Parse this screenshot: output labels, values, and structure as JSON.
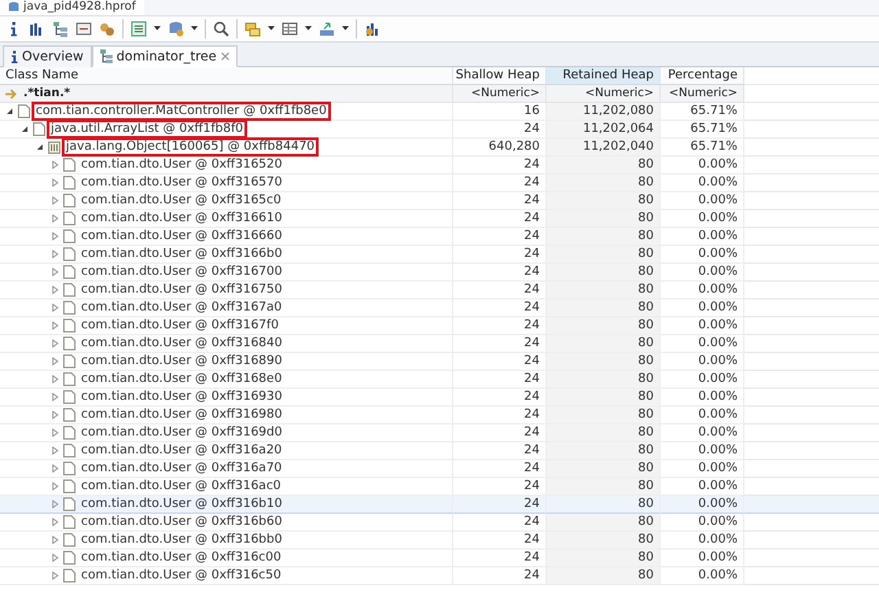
{
  "editor_tab": {
    "title": "java_pid4928.hprof"
  },
  "view_tabs": [
    {
      "label": "Overview",
      "selected": false
    },
    {
      "label": "dominator_tree",
      "selected": true
    }
  ],
  "table": {
    "columns": [
      {
        "label": "Class Name",
        "sorted": false
      },
      {
        "label": "Shallow Heap",
        "sorted": false
      },
      {
        "label": "Retained Heap",
        "sorted": true
      },
      {
        "label": "Percentage",
        "sorted": false
      }
    ],
    "filter": {
      "class_name": ".*tian.*",
      "shallow": "<Numeric>",
      "retained": "<Numeric>",
      "percentage": "<Numeric>"
    },
    "rows": [
      {
        "kind": "object",
        "name": "com.tian.controller.MatController @ 0xff1fb8e0",
        "shallow": "16",
        "retained": "11,202,080",
        "percentage": "65.71%",
        "expanded": true,
        "annotated": true,
        "selected": false,
        "children": [
          {
            "kind": "object",
            "name": "java.util.ArrayList @ 0xff1fb8f0",
            "shallow": "24",
            "retained": "11,202,064",
            "percentage": "65.71%",
            "expanded": true,
            "annotated": true,
            "selected": false,
            "children": [
              {
                "kind": "array",
                "name": "java.lang.Object[160065] @ 0xffb84470",
                "shallow": "640,280",
                "retained": "11,202,040",
                "percentage": "65.71%",
                "expanded": true,
                "annotated": true,
                "selected": false,
                "children": [
                  {
                    "kind": "object",
                    "name": "com.tian.dto.User @ 0xff316520",
                    "shallow": "24",
                    "retained": "80",
                    "percentage": "0.00%",
                    "expanded": false,
                    "annotated": false,
                    "selected": false
                  },
                  {
                    "kind": "object",
                    "name": "com.tian.dto.User @ 0xff316570",
                    "shallow": "24",
                    "retained": "80",
                    "percentage": "0.00%",
                    "expanded": false,
                    "annotated": false,
                    "selected": false
                  },
                  {
                    "kind": "object",
                    "name": "com.tian.dto.User @ 0xff3165c0",
                    "shallow": "24",
                    "retained": "80",
                    "percentage": "0.00%",
                    "expanded": false,
                    "annotated": false,
                    "selected": false
                  },
                  {
                    "kind": "object",
                    "name": "com.tian.dto.User @ 0xff316610",
                    "shallow": "24",
                    "retained": "80",
                    "percentage": "0.00%",
                    "expanded": false,
                    "annotated": false,
                    "selected": false
                  },
                  {
                    "kind": "object",
                    "name": "com.tian.dto.User @ 0xff316660",
                    "shallow": "24",
                    "retained": "80",
                    "percentage": "0.00%",
                    "expanded": false,
                    "annotated": false,
                    "selected": false
                  },
                  {
                    "kind": "object",
                    "name": "com.tian.dto.User @ 0xff3166b0",
                    "shallow": "24",
                    "retained": "80",
                    "percentage": "0.00%",
                    "expanded": false,
                    "annotated": false,
                    "selected": false
                  },
                  {
                    "kind": "object",
                    "name": "com.tian.dto.User @ 0xff316700",
                    "shallow": "24",
                    "retained": "80",
                    "percentage": "0.00%",
                    "expanded": false,
                    "annotated": false,
                    "selected": false
                  },
                  {
                    "kind": "object",
                    "name": "com.tian.dto.User @ 0xff316750",
                    "shallow": "24",
                    "retained": "80",
                    "percentage": "0.00%",
                    "expanded": false,
                    "annotated": false,
                    "selected": false
                  },
                  {
                    "kind": "object",
                    "name": "com.tian.dto.User @ 0xff3167a0",
                    "shallow": "24",
                    "retained": "80",
                    "percentage": "0.00%",
                    "expanded": false,
                    "annotated": false,
                    "selected": false
                  },
                  {
                    "kind": "object",
                    "name": "com.tian.dto.User @ 0xff3167f0",
                    "shallow": "24",
                    "retained": "80",
                    "percentage": "0.00%",
                    "expanded": false,
                    "annotated": false,
                    "selected": false
                  },
                  {
                    "kind": "object",
                    "name": "com.tian.dto.User @ 0xff316840",
                    "shallow": "24",
                    "retained": "80",
                    "percentage": "0.00%",
                    "expanded": false,
                    "annotated": false,
                    "selected": false
                  },
                  {
                    "kind": "object",
                    "name": "com.tian.dto.User @ 0xff316890",
                    "shallow": "24",
                    "retained": "80",
                    "percentage": "0.00%",
                    "expanded": false,
                    "annotated": false,
                    "selected": false
                  },
                  {
                    "kind": "object",
                    "name": "com.tian.dto.User @ 0xff3168e0",
                    "shallow": "24",
                    "retained": "80",
                    "percentage": "0.00%",
                    "expanded": false,
                    "annotated": false,
                    "selected": false
                  },
                  {
                    "kind": "object",
                    "name": "com.tian.dto.User @ 0xff316930",
                    "shallow": "24",
                    "retained": "80",
                    "percentage": "0.00%",
                    "expanded": false,
                    "annotated": false,
                    "selected": false
                  },
                  {
                    "kind": "object",
                    "name": "com.tian.dto.User @ 0xff316980",
                    "shallow": "24",
                    "retained": "80",
                    "percentage": "0.00%",
                    "expanded": false,
                    "annotated": false,
                    "selected": false
                  },
                  {
                    "kind": "object",
                    "name": "com.tian.dto.User @ 0xff3169d0",
                    "shallow": "24",
                    "retained": "80",
                    "percentage": "0.00%",
                    "expanded": false,
                    "annotated": false,
                    "selected": false
                  },
                  {
                    "kind": "object",
                    "name": "com.tian.dto.User @ 0xff316a20",
                    "shallow": "24",
                    "retained": "80",
                    "percentage": "0.00%",
                    "expanded": false,
                    "annotated": false,
                    "selected": false
                  },
                  {
                    "kind": "object",
                    "name": "com.tian.dto.User @ 0xff316a70",
                    "shallow": "24",
                    "retained": "80",
                    "percentage": "0.00%",
                    "expanded": false,
                    "annotated": false,
                    "selected": false
                  },
                  {
                    "kind": "object",
                    "name": "com.tian.dto.User @ 0xff316ac0",
                    "shallow": "24",
                    "retained": "80",
                    "percentage": "0.00%",
                    "expanded": false,
                    "annotated": false,
                    "selected": false
                  },
                  {
                    "kind": "object",
                    "name": "com.tian.dto.User @ 0xff316b10",
                    "shallow": "24",
                    "retained": "80",
                    "percentage": "0.00%",
                    "expanded": false,
                    "annotated": false,
                    "selected": true
                  },
                  {
                    "kind": "object",
                    "name": "com.tian.dto.User @ 0xff316b60",
                    "shallow": "24",
                    "retained": "80",
                    "percentage": "0.00%",
                    "expanded": false,
                    "annotated": false,
                    "selected": false
                  },
                  {
                    "kind": "object",
                    "name": "com.tian.dto.User @ 0xff316bb0",
                    "shallow": "24",
                    "retained": "80",
                    "percentage": "0.00%",
                    "expanded": false,
                    "annotated": false,
                    "selected": false
                  },
                  {
                    "kind": "object",
                    "name": "com.tian.dto.User @ 0xff316c00",
                    "shallow": "24",
                    "retained": "80",
                    "percentage": "0.00%",
                    "expanded": false,
                    "annotated": false,
                    "selected": false
                  },
                  {
                    "kind": "object",
                    "name": "com.tian.dto.User @ 0xff316c50",
                    "shallow": "24",
                    "retained": "80",
                    "percentage": "0.00%",
                    "expanded": false,
                    "annotated": false,
                    "selected": false
                  }
                ]
              }
            ]
          }
        ]
      }
    ]
  }
}
